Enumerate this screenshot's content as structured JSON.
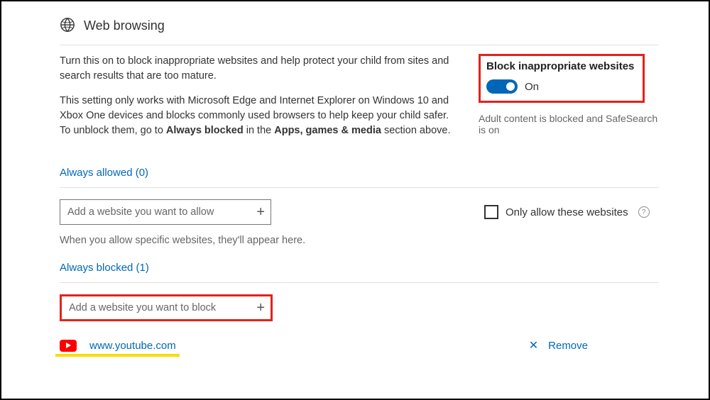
{
  "header": {
    "title": "Web browsing"
  },
  "description": {
    "p1": "Turn this on to block inappropriate websites and help protect your child from sites and search results that are too mature.",
    "p2_pre": "This setting only works with Microsoft Edge and Internet Explorer on Windows 10 and Xbox One devices and blocks commonly used browsers to help keep your child safer. To unblock them, go to ",
    "p2_b1": "Always blocked",
    "p2_mid": " in the ",
    "p2_b2": "Apps, games & media",
    "p2_post": " section above."
  },
  "block_panel": {
    "title": "Block inappropriate websites",
    "toggle_state": "On",
    "status": "Adult content is blocked and SafeSearch is on"
  },
  "always_allowed": {
    "link": "Always allowed (0)",
    "placeholder": "Add a website you want to allow",
    "hint": "When you allow specific websites, they'll appear here."
  },
  "only_allow": {
    "label": "Only allow these websites"
  },
  "always_blocked": {
    "link": "Always blocked (1)",
    "placeholder": "Add a website you want to block"
  },
  "blocked_items": [
    {
      "url": "www.youtube.com",
      "remove_label": "Remove"
    }
  ]
}
